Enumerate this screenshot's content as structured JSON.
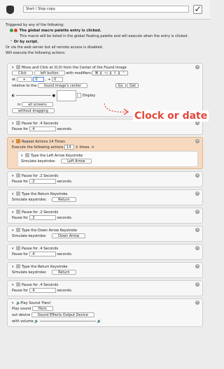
{
  "macro": {
    "name": "Start / Stop copy",
    "enabled_mark": "✓"
  },
  "triggers": {
    "heading": "Triggered by any of the following:",
    "palette_entry": "The global macro palette entry is clicked.",
    "palette_note": "This macro will be listed in the global floating palette and will execute when the entry is clicked.",
    "or_script": "Or by script.",
    "web_server": "Or via the web server but all remote access is disabled."
  },
  "actions_heading": "Will execute the following actions:",
  "move_click": {
    "title": "Move and Click at (0,0) from the Center of the Found Image",
    "click_label": "Click",
    "button_label": "left button",
    "modifiers_label": "with modifiers",
    "modifier_keys": [
      "⌘",
      "⌥",
      "⇧",
      "⌃"
    ],
    "at_label": "at",
    "x_value": "0",
    "y_value": "0",
    "relative_to_label": "relative to the",
    "relative_value": "found image's center",
    "go_label": "Go",
    "get_label": "Get",
    "display_label": "Display",
    "in_label": "in",
    "screens_value": "all screens",
    "dragging_value": "without dragging"
  },
  "annotation": "Clock or date",
  "pause_label": "Pause for",
  "seconds_label": "seconds.",
  "cards": [
    {
      "title": "Pause for .4 Seconds",
      "value": ".4"
    }
  ],
  "repeat": {
    "title": "Repeat Actions 14 Times",
    "execute_label": "Execute the following actions",
    "count": "14",
    "times_label": "times.",
    "inner_title": "Type the Left Arrow Keystroke",
    "simulate_label": "Simulate keystroke:",
    "inner_key": "Left Arrow"
  },
  "after": [
    {
      "kind": "pause",
      "title": "Pause for .2 Seconds",
      "value": ".2"
    },
    {
      "kind": "type",
      "title": "Type the Return Keystroke",
      "key": "Return"
    },
    {
      "kind": "pause",
      "title": "Pause for .2 Seconds",
      "value": ".2"
    },
    {
      "kind": "type",
      "title": "Type the Down Arrow Keystroke",
      "key": "Down Arrow"
    },
    {
      "kind": "pause",
      "title": "Pause for .4 Seconds",
      "value": ".4"
    },
    {
      "kind": "type",
      "title": "Type the Return Keystroke",
      "key": "Return"
    },
    {
      "kind": "pause",
      "title": "Pause for .4 Seconds",
      "value": ".4"
    }
  ],
  "sound": {
    "title": "Play Sound 'Hero'",
    "play_label": "Play sound",
    "play_value": "Hero",
    "out_label": "out device",
    "out_value": "Sound Effects Output Device",
    "volume_label": "with volume"
  }
}
